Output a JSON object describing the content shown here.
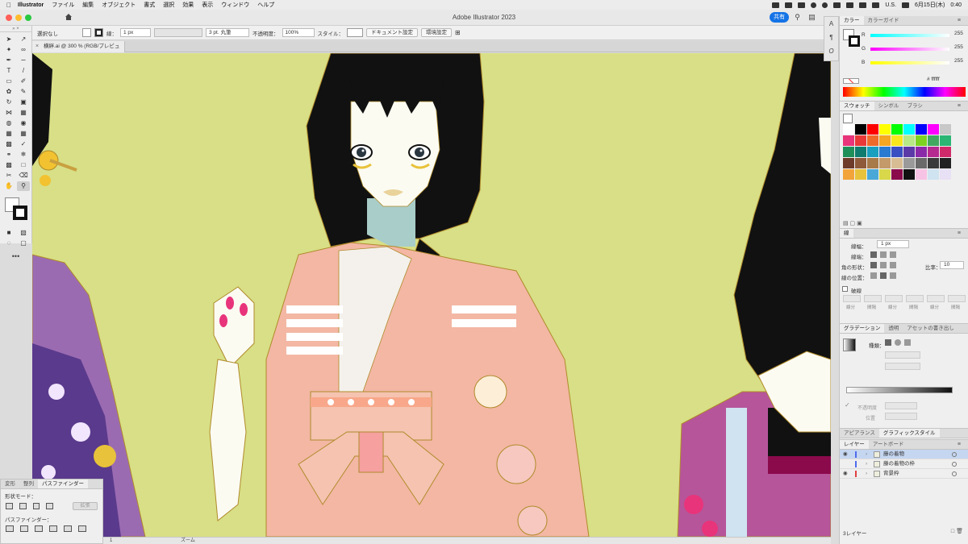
{
  "menubar": {
    "app": "Illustrator",
    "items": [
      "ファイル",
      "編集",
      "オブジェクト",
      "書式",
      "選択",
      "効果",
      "表示",
      "ウィンドウ",
      "ヘルプ"
    ],
    "input_source": "U.S.",
    "date": "6月15日(木)",
    "time": "0:40"
  },
  "window": {
    "title": "Adobe Illustrator 2023",
    "share_label": "共有"
  },
  "control_bar": {
    "selection": "選択なし",
    "stroke_label": "線：",
    "stroke_width": "1 px",
    "brush": "3 pt. 丸筆",
    "opacity_label": "不透明度：",
    "opacity_value": "100%",
    "style_label": "スタイル：",
    "doc_settings": "ドキュメント設定",
    "prefs": "環境設定"
  },
  "doc_tab": {
    "title": "横絆.ai @ 300 % (RGB/プレビュー)"
  },
  "status": {
    "zoom_value": "1",
    "zoom_label": "ズーム"
  },
  "pathfinder": {
    "tabs": [
      "変形",
      "整列",
      "パスファインダー"
    ],
    "shape_mode": "形状モード：",
    "pathfinders": "パスファインダー：",
    "expand": "拡張"
  },
  "color_panel": {
    "tabs": [
      "カラー",
      "カラーガイド"
    ],
    "r_label": "R",
    "g_label": "G",
    "b_label": "B",
    "r": "255",
    "g": "255",
    "b": "255",
    "hex": "ffffff"
  },
  "swatch_panel": {
    "tabs": [
      "スウォッチ",
      "シンボル",
      "ブラシ"
    ]
  },
  "stroke_panel": {
    "title": "線",
    "weight_label": "線幅：",
    "weight": "1 px",
    "cap_label": "線端：",
    "corner_label": "角の形状：",
    "ratio_label": "比率：",
    "ratio": "10",
    "align_label": "線の位置：",
    "dash_label": "破線",
    "dash_fields": [
      "線分",
      "間隔",
      "線分",
      "間隔",
      "線分",
      "間隔"
    ]
  },
  "gradient_panel": {
    "tabs": [
      "グラデーション",
      "透明",
      "アセットの書き出し"
    ],
    "type_label": "種類：",
    "opacity_label": "不透明度",
    "location_label": "位置"
  },
  "appearance_panel": {
    "tabs": [
      "アピアランス",
      "グラフィックスタイル"
    ]
  },
  "layers_panel": {
    "tabs": [
      "レイヤー",
      "アートボード"
    ],
    "layers": [
      {
        "name": "藤の着物",
        "color": "#4f6bed",
        "selected": true,
        "visible": true
      },
      {
        "name": "藤の着物の枠",
        "color": "#4f6bed",
        "selected": false,
        "visible": false
      },
      {
        "name": "背景枠",
        "color": "#e04040",
        "selected": false,
        "visible": true
      }
    ],
    "count": "3レイヤー"
  },
  "colors": {
    "canvas_bg": "#d8df86",
    "accent": "#1473e6"
  }
}
